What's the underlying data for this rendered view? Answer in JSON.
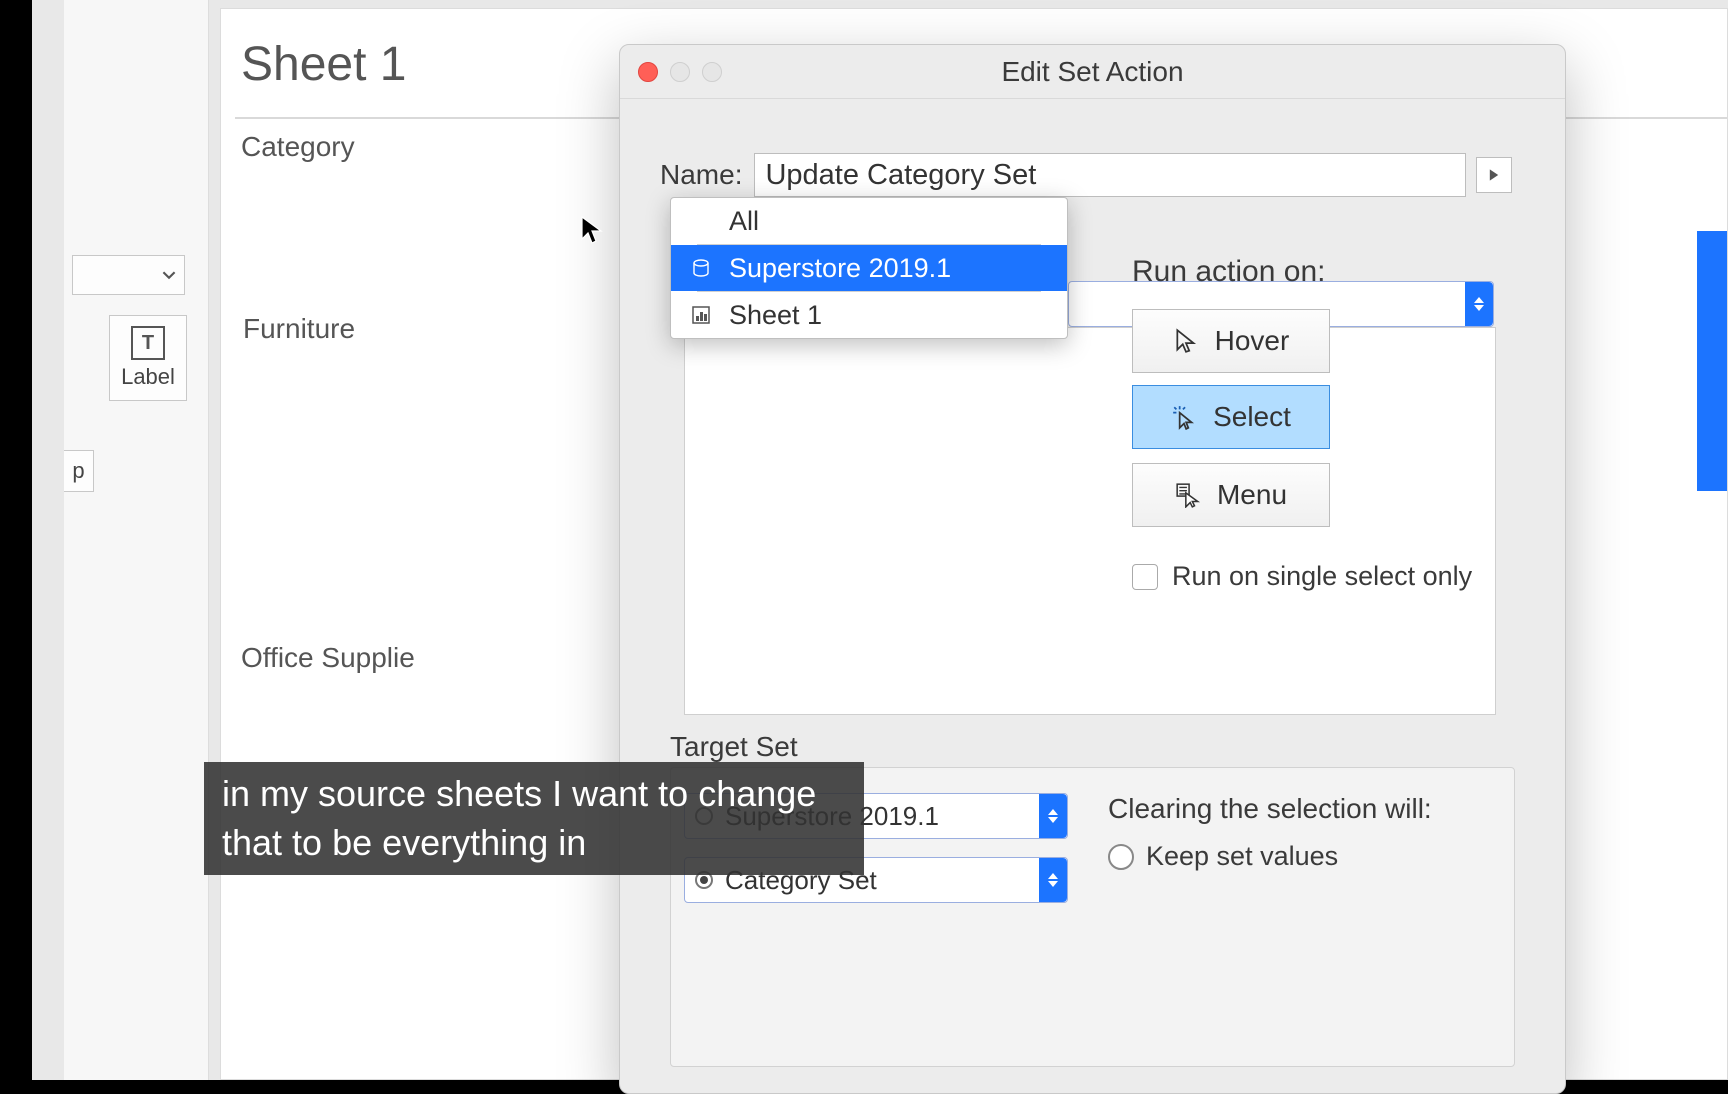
{
  "sheet": {
    "title": "Sheet 1",
    "header": "Category",
    "rows": [
      "Furniture",
      "Office Supplie"
    ]
  },
  "leftPanel": {
    "labelCard": {
      "icon": "T",
      "text": "Label"
    },
    "fragText": "p"
  },
  "dialog": {
    "title": "Edit Set Action",
    "name": {
      "label": "Name:",
      "value": "Update Category Set"
    },
    "dropdown": {
      "all": "All",
      "options": [
        {
          "label": "Superstore 2019.1",
          "icon": "datasource",
          "highlighted": true
        },
        {
          "label": "Sheet 1",
          "icon": "worksheet",
          "highlighted": false
        }
      ]
    },
    "runAction": {
      "label": "Run action on:",
      "hover": "Hover",
      "select": "Select",
      "menu": "Menu"
    },
    "singleSelect": "Run on single select only",
    "targetSet": {
      "label": "Target Set",
      "datasource": "Superstore 2019.1",
      "set": "Category Set"
    },
    "clearing": {
      "label": "Clearing the selection will:",
      "opt1": "Keep set values"
    }
  },
  "caption": "in my source sheets I want to change that to be everything in"
}
